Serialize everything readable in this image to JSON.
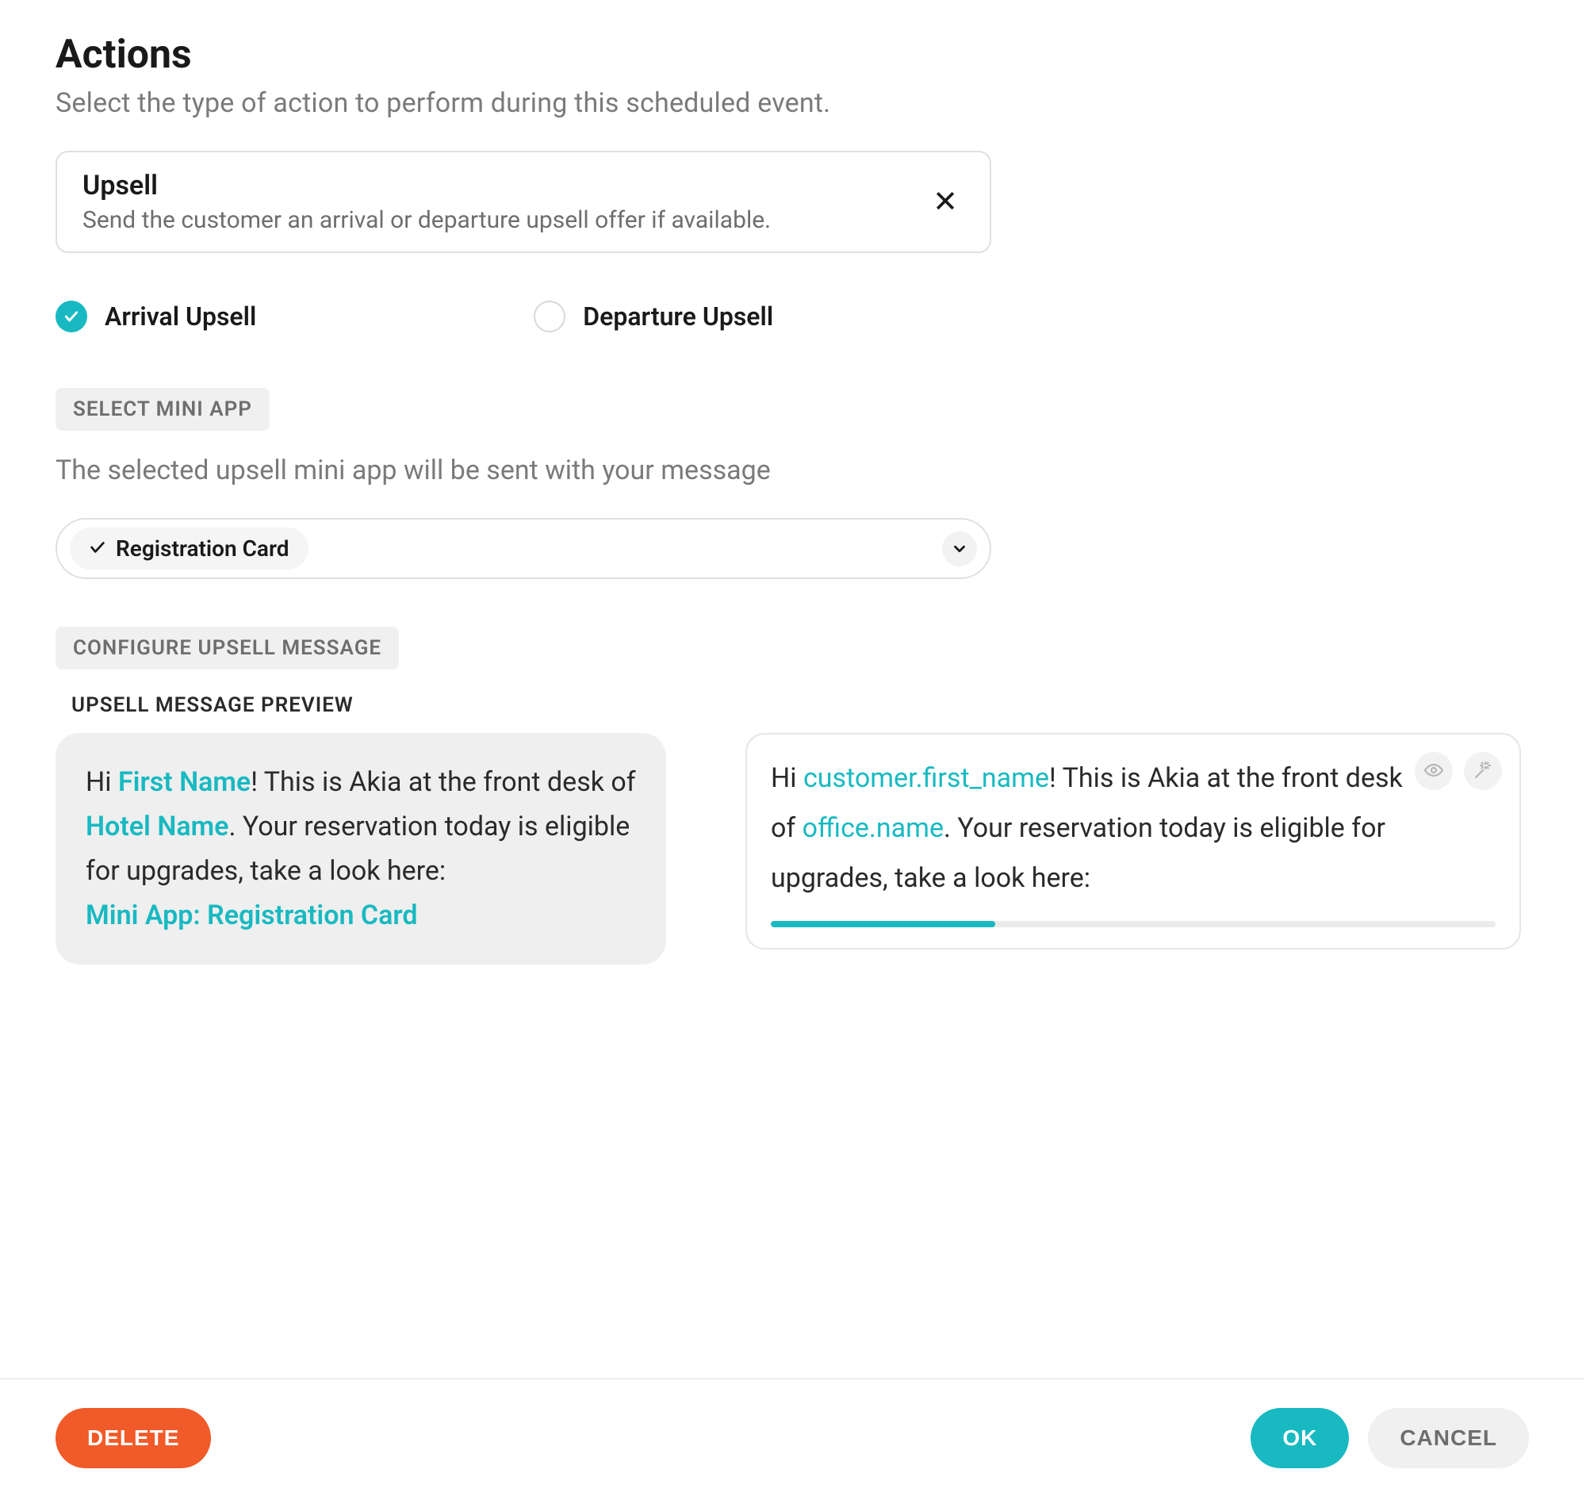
{
  "header": {
    "title": "Actions",
    "subtitle": "Select the type of action to perform during this scheduled event."
  },
  "action_card": {
    "title": "Upsell",
    "description": "Send the customer an arrival or departure upsell offer if available."
  },
  "radios": {
    "arrival": "Arrival Upsell",
    "departure": "Departure Upsell"
  },
  "mini_app_section": {
    "badge": "SELECT MINI APP",
    "description": "The selected upsell mini app will be sent with your message",
    "selected": "Registration Card"
  },
  "configure_section": {
    "badge": "CONFIGURE UPSELL MESSAGE",
    "preview_label": "UPSELL MESSAGE PREVIEW"
  },
  "preview_left": {
    "p1": "Hi ",
    "first_name": "First Name",
    "p2": "! This is Akia at the front desk of ",
    "hotel_name": "Hotel Name",
    "p3": ". Your reservation today is eligible for upgrades, take a look here:",
    "miniapp": "Mini App: Registration Card"
  },
  "preview_right": {
    "p1": "Hi ",
    "var1": "customer.first_name",
    "p2": "! This is Akia at the front desk of ",
    "var2": "office.name",
    "p3": ". Your reservation today is eligible for upgrades, take a look here:"
  },
  "footer": {
    "delete": "DELETE",
    "ok": "OK",
    "cancel": "CANCEL"
  }
}
